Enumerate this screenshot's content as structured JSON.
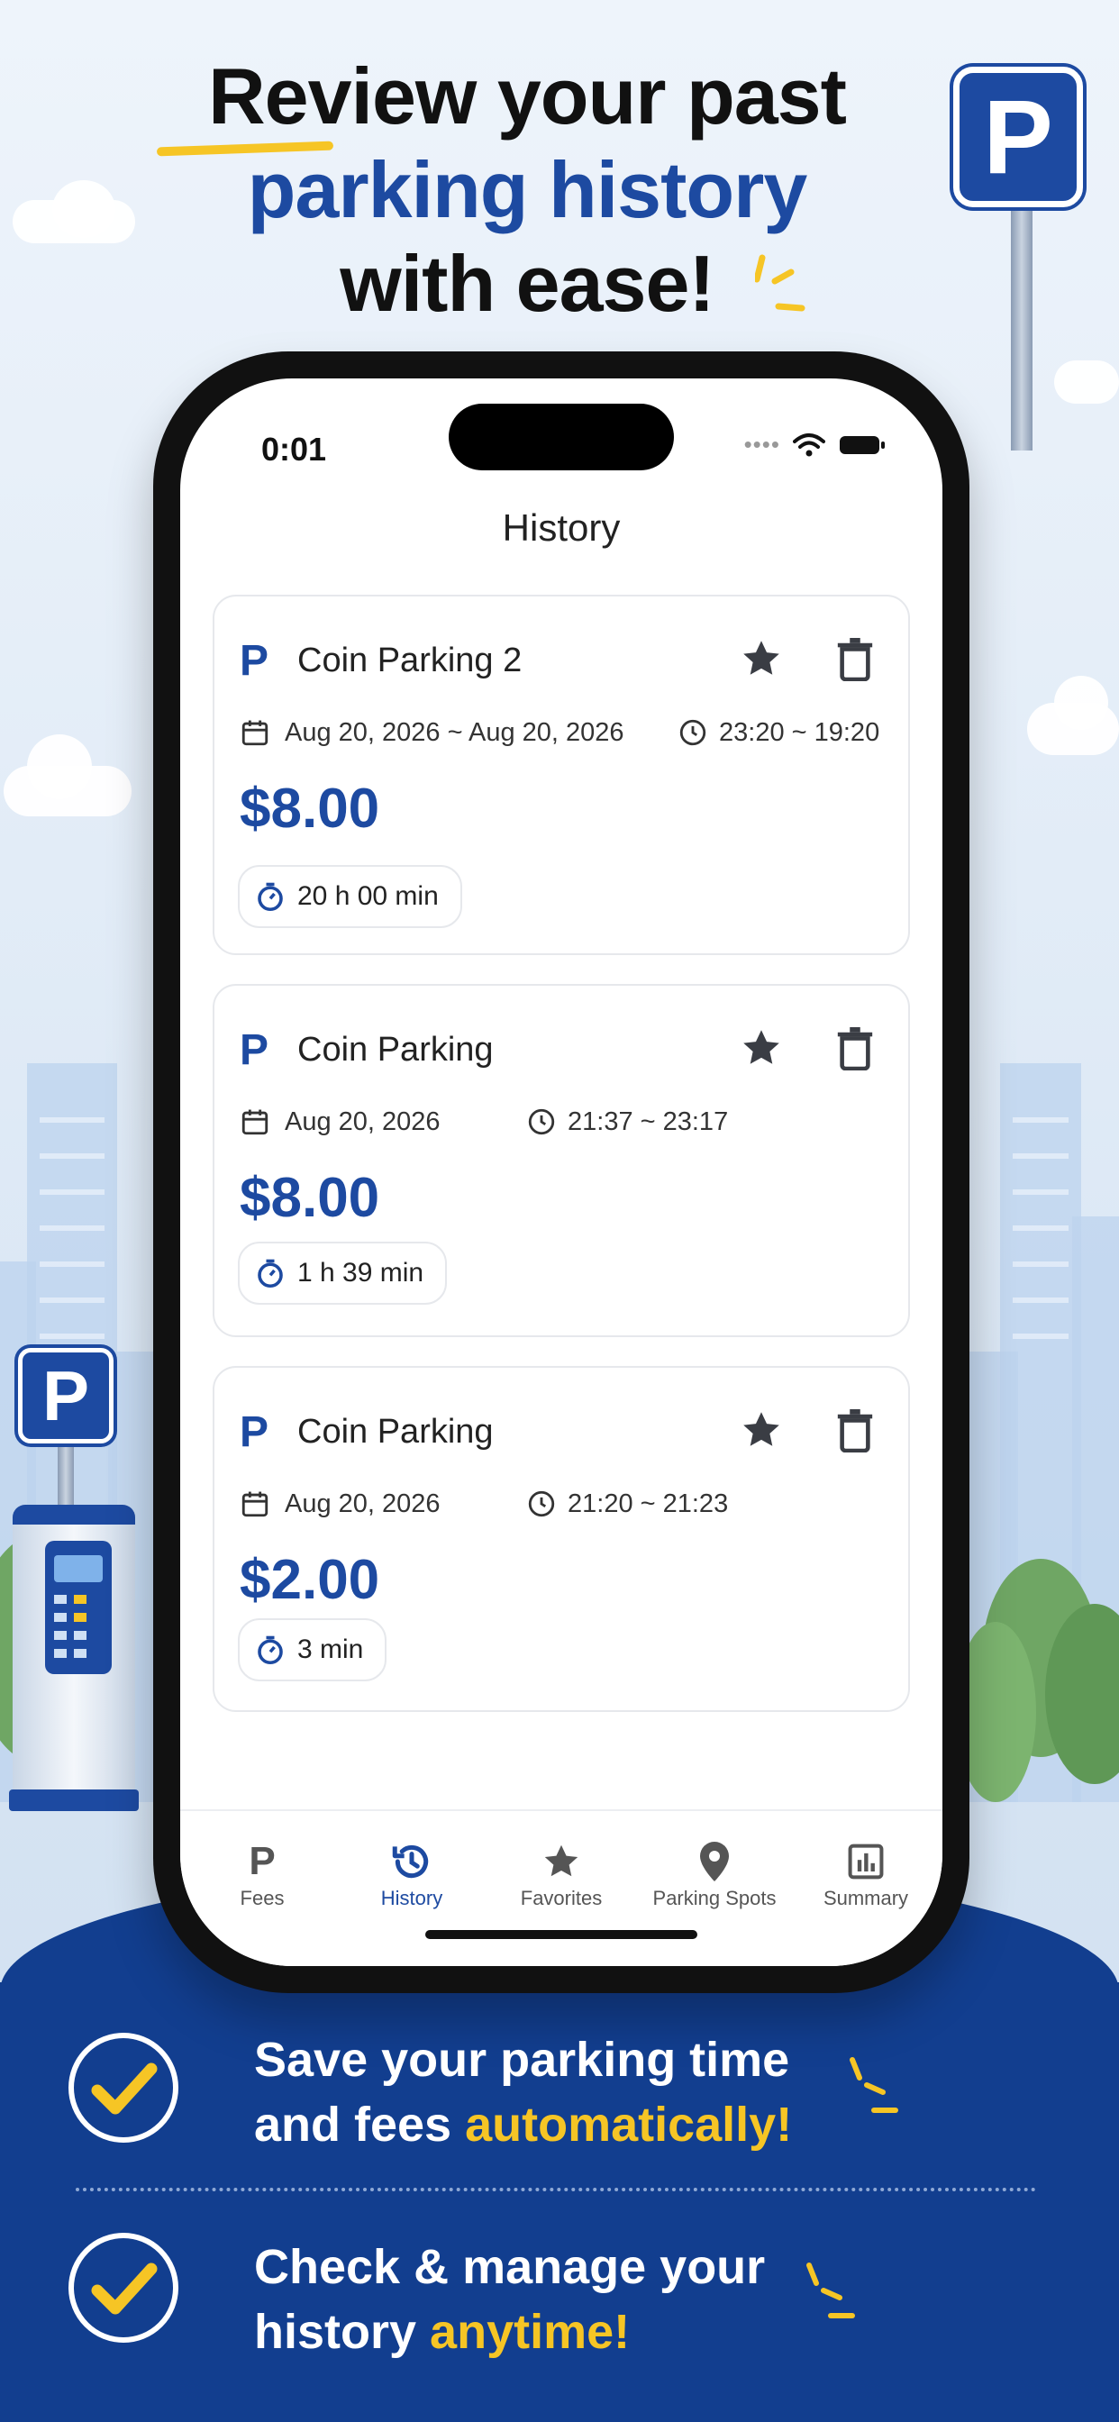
{
  "headline": {
    "line1": "Review your past",
    "line2": "parking history",
    "line3": "with ease!"
  },
  "status_bar": {
    "time": "0:01"
  },
  "nav": {
    "title": "History"
  },
  "history": [
    {
      "name": "Coin Parking 2",
      "date": "Aug 20, 2026 ~ Aug 20, 2026",
      "time": "23:20 ~ 19:20",
      "price": "$8.00",
      "duration": "20 h 00 min"
    },
    {
      "name": "Coin Parking",
      "date": "Aug 20, 2026",
      "time": "21:37 ~ 23:17",
      "price": "$8.00",
      "duration": "1 h 39 min"
    },
    {
      "name": "Coin Parking",
      "date": "Aug 20, 2026",
      "time": "21:20 ~ 21:23",
      "price": "$2.00",
      "duration": "3 min"
    }
  ],
  "tabs": [
    {
      "label": "Fees",
      "icon": "parking-p-icon"
    },
    {
      "label": "History",
      "icon": "history-icon",
      "active": true
    },
    {
      "label": "Favorites",
      "icon": "star-icon"
    },
    {
      "label": "Parking Spots",
      "icon": "location-pin-icon"
    },
    {
      "label": "Summary",
      "icon": "bar-chart-icon"
    }
  ],
  "features": [
    {
      "text1": "Save your parking time",
      "text2a": "and fees ",
      "text2b": "automatically!"
    },
    {
      "text1": "Check & manage your",
      "text2a": "history ",
      "text2b": "anytime!"
    }
  ],
  "sign_letter": "P",
  "colors": {
    "brand_blue": "#1d4aa1",
    "accent_yellow": "#f6c525",
    "banner_blue": "#123e8f"
  }
}
